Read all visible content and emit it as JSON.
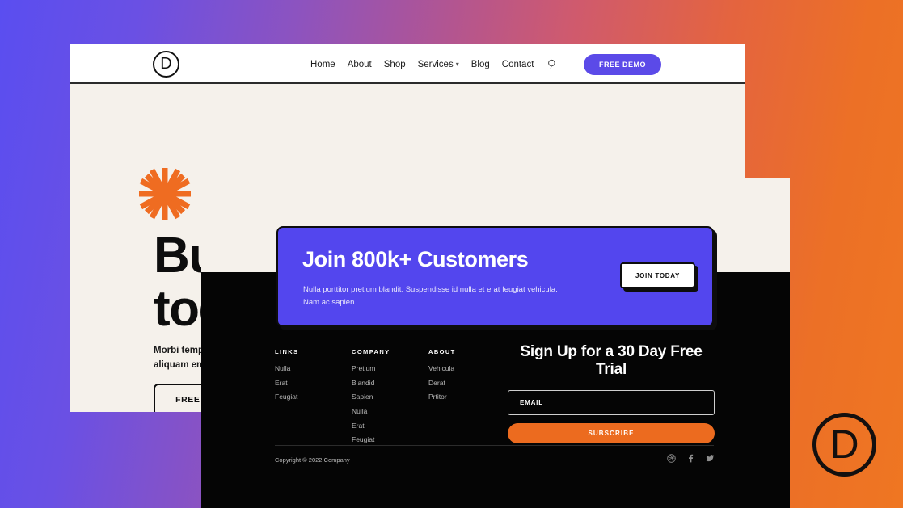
{
  "background": {
    "gradient_start": "#5a4ef0",
    "gradient_mid": "#c05a7c",
    "gradient_end": "#ef7622"
  },
  "watermark": {
    "logo_letter": "D"
  },
  "browser": {
    "nav": {
      "logo_letter": "D",
      "menu": [
        {
          "label": "Home",
          "has_caret": false
        },
        {
          "label": "About",
          "has_caret": false
        },
        {
          "label": "Shop",
          "has_caret": false
        },
        {
          "label": "Services",
          "has_caret": true
        },
        {
          "label": "Blog",
          "has_caret": false
        },
        {
          "label": "Contact",
          "has_caret": false
        }
      ],
      "search_icon": "search-icon",
      "cta_label": "FREE DEMO",
      "cta_color": "#5b4ae8"
    },
    "hero": {
      "heading": "Bu\ntog",
      "body": "Morbi tempo\naliquam enim",
      "button_label": "FREE DEMO"
    }
  },
  "overlay": {
    "cta_card": {
      "title": "Join 800k+ Customers",
      "body": "Nulla porttitor pretium blandit. Suspendisse id nulla et erat feugiat vehicula.\nNam ac sapien.",
      "button_label": "JOIN TODAY",
      "card_color": "#5346ee"
    },
    "footer": {
      "columns": [
        {
          "title": "LINKS",
          "links": [
            "Nulla",
            "Erat",
            "Feugiat"
          ]
        },
        {
          "title": "COMPANY",
          "links": [
            "Pretium",
            "Blandid",
            "Sapien",
            "Nulla",
            "Erat",
            "Feugiat"
          ]
        },
        {
          "title": "ABOUT",
          "links": [
            "Vehicula",
            "Derat",
            "Prtitor"
          ]
        }
      ],
      "signup": {
        "heading": "Sign Up for a 30 Day Free Trial",
        "email_placeholder": "EMAIL",
        "email_value": "",
        "subscribe_label": "SUBSCRIBE",
        "subscribe_color": "#ec6b1f"
      },
      "copyright": "Copyright © 2022 Company",
      "socials": [
        "dribbble-icon",
        "facebook-icon",
        "twitter-icon"
      ]
    }
  }
}
